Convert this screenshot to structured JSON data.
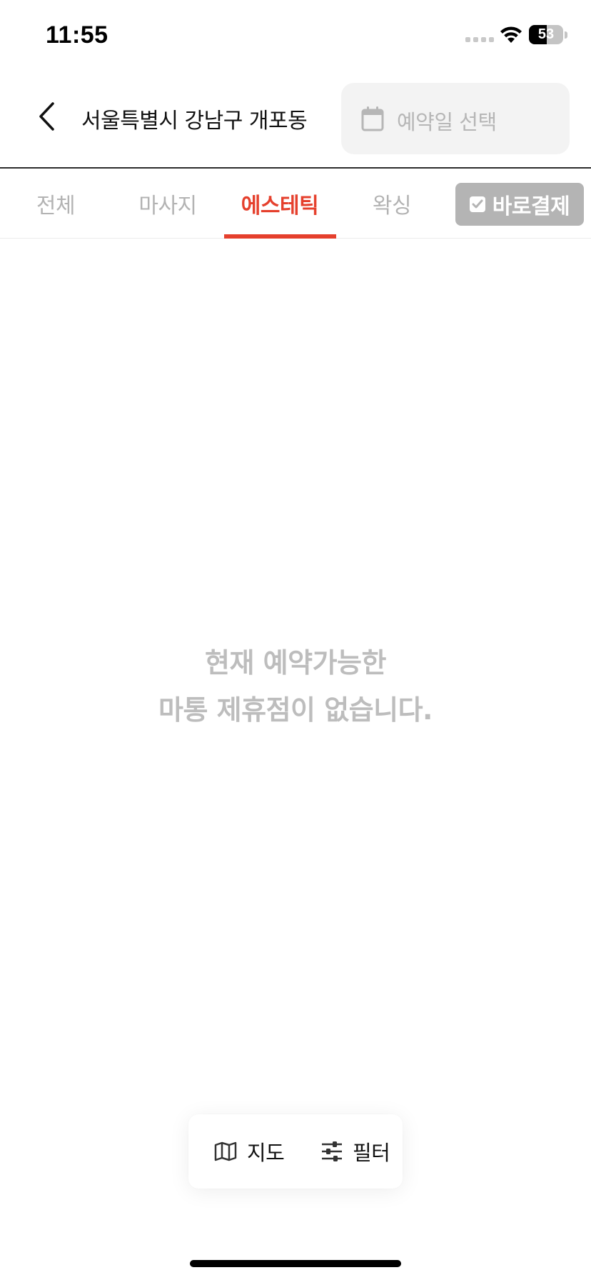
{
  "status_bar": {
    "time": "11:55",
    "battery_level": "53",
    "battery_percent": 53
  },
  "header": {
    "location": "서울특별시 강남구 개포동",
    "date_picker_placeholder": "예약일 선택"
  },
  "tabs": [
    {
      "label": "전체",
      "active": false
    },
    {
      "label": "마사지",
      "active": false
    },
    {
      "label": "에스테틱",
      "active": true
    },
    {
      "label": "왁싱",
      "active": false
    }
  ],
  "direct_pay": {
    "label": "바로결제",
    "checked": true
  },
  "empty_state": {
    "line1": "현재 예약가능한",
    "line2": "마통 제휴점이 없습니다."
  },
  "floating_bar": {
    "map_label": "지도",
    "filter_label": "필터"
  },
  "colors": {
    "accent": "#e5402d",
    "muted_text": "#b3b3b3",
    "empty_text": "#bdbdbd",
    "direct_pay_bg": "#b4b4b4",
    "date_picker_bg": "#f3f3f3"
  },
  "icons": {
    "back": "chevron-left-icon",
    "calendar": "calendar-icon",
    "check": "checkbox-checked-icon",
    "map": "map-icon",
    "filter": "sliders-icon"
  }
}
